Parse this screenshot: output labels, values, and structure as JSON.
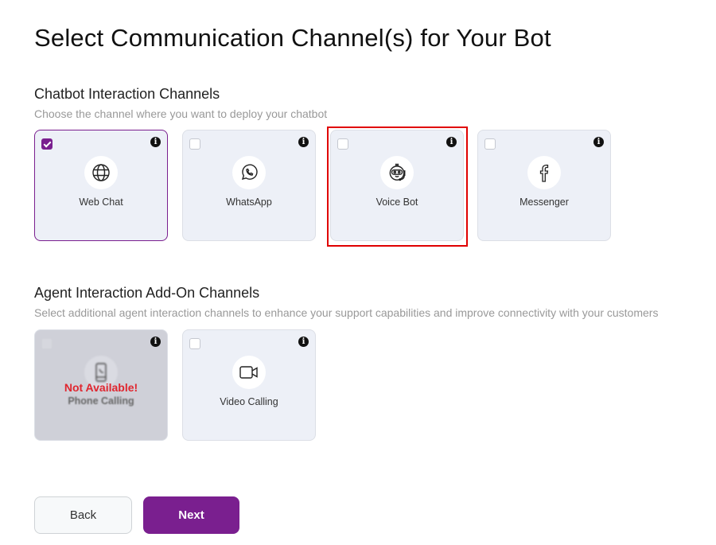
{
  "page": {
    "title": "Select Communication Channel(s) for Your Bot"
  },
  "chatbot_section": {
    "title": "Chatbot Interaction Channels",
    "subtitle": "Choose the channel where you want to deploy your chatbot",
    "channels": [
      {
        "label": "Web Chat",
        "icon": "globe-icon",
        "checked": true
      },
      {
        "label": "WhatsApp",
        "icon": "whatsapp-icon",
        "checked": false
      },
      {
        "label": "Voice Bot",
        "icon": "voice-bot-icon",
        "checked": false,
        "highlighted": true
      },
      {
        "label": "Messenger",
        "icon": "facebook-icon",
        "checked": false
      }
    ]
  },
  "agent_section": {
    "title": "Agent Interaction Add-On Channels",
    "subtitle": "Select additional agent interaction channels to enhance your support capabilities and improve connectivity with your customers",
    "channels": [
      {
        "label": "Phone Calling",
        "icon": "phone-call-icon",
        "checked": false,
        "disabled": true,
        "overlay": "Not Available!"
      },
      {
        "label": "Video Calling",
        "icon": "video-camera-icon",
        "checked": false
      }
    ]
  },
  "info_glyph": "i",
  "footer": {
    "back_label": "Back",
    "next_label": "Next"
  },
  "colors": {
    "accent": "#7a1f8f",
    "highlight": "#e00000",
    "not_available": "#e0262f"
  }
}
